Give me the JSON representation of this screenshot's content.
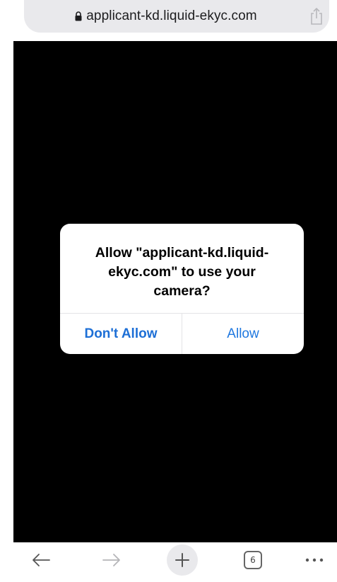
{
  "browser": {
    "url": "applicant-kd.liquid-ekyc.com",
    "tab_count": "6"
  },
  "icons": {
    "lock": "lock-icon",
    "share": "share-icon",
    "back": "back-arrow-icon",
    "forward": "forward-arrow-icon",
    "new_tab": "plus-icon",
    "tabs": "tabs-icon",
    "more": "more-icon"
  },
  "dialog": {
    "message": "Allow \"applicant-kd.liquid-ekyc.com\" to use your camera?",
    "deny_label": "Don't Allow",
    "allow_label": "Allow"
  },
  "colors": {
    "accent": "#1a73e8",
    "camera_bg": "#000000"
  }
}
